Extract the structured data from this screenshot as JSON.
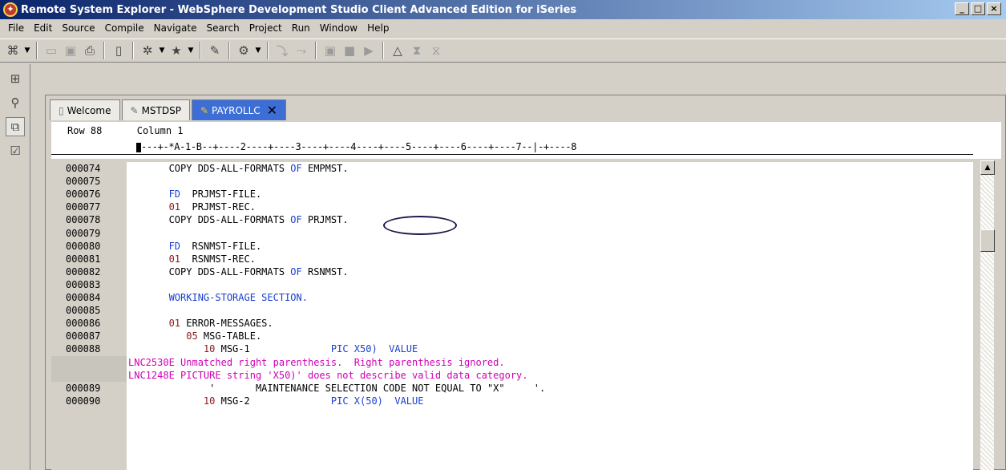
{
  "window": {
    "title": "Remote System Explorer - WebSphere Development Studio Client Advanced Edition for iSeries",
    "minimize": "_",
    "maximize": "□",
    "close": "×"
  },
  "menu": [
    "File",
    "Edit",
    "Source",
    "Compile",
    "Navigate",
    "Search",
    "Project",
    "Run",
    "Window",
    "Help"
  ],
  "tabs": [
    {
      "label": "Welcome",
      "icon": "page-icon"
    },
    {
      "label": "MSTDSP",
      "icon": "pencil-icon"
    },
    {
      "label": "PAYROLLC",
      "icon": "pencil-icon",
      "active": true,
      "close": "✕"
    }
  ],
  "editor": {
    "status_row": "Row 88",
    "status_column": "Column 1",
    "ruler": "---+-*A-1-B--+----2----+----3----+----4----+----5----+----6----+----7--|-+----8",
    "lines": [
      {
        "seq": "000074",
        "parts": [
          {
            "t": "COPY DDS-ALL-FORMATS ",
            "c": "txt"
          },
          {
            "t": "OF",
            "c": "kw"
          },
          {
            "t": " EMPMST.",
            "c": "txt"
          }
        ],
        "indent": "       "
      },
      {
        "seq": "000075",
        "parts": [],
        "indent": ""
      },
      {
        "seq": "000076",
        "parts": [
          {
            "t": "FD",
            "c": "kw"
          },
          {
            "t": "  PRJMST-FILE.",
            "c": "txt"
          }
        ],
        "indent": "       "
      },
      {
        "seq": "000077",
        "parts": [
          {
            "t": "01",
            "c": "num"
          },
          {
            "t": "  PRJMST-REC.",
            "c": "txt"
          }
        ],
        "indent": "       "
      },
      {
        "seq": "000078",
        "parts": [
          {
            "t": "COPY DDS-ALL-FORMATS ",
            "c": "txt"
          },
          {
            "t": "OF",
            "c": "kw"
          },
          {
            "t": " PRJMST.",
            "c": "txt"
          }
        ],
        "indent": "       "
      },
      {
        "seq": "000079",
        "parts": [],
        "indent": ""
      },
      {
        "seq": "000080",
        "parts": [
          {
            "t": "FD",
            "c": "kw"
          },
          {
            "t": "  RSNMST-FILE.",
            "c": "txt"
          }
        ],
        "indent": "       "
      },
      {
        "seq": "000081",
        "parts": [
          {
            "t": "01",
            "c": "num"
          },
          {
            "t": "  RSNMST-REC.",
            "c": "txt"
          }
        ],
        "indent": "       "
      },
      {
        "seq": "000082",
        "parts": [
          {
            "t": "COPY DDS-ALL-FORMATS ",
            "c": "txt"
          },
          {
            "t": "OF",
            "c": "kw"
          },
          {
            "t": " RSNMST.",
            "c": "txt"
          }
        ],
        "indent": "       "
      },
      {
        "seq": "000083",
        "parts": [],
        "indent": ""
      },
      {
        "seq": "000084",
        "parts": [
          {
            "t": "WORKING-STORAGE SECTION.",
            "c": "kw"
          }
        ],
        "indent": "       "
      },
      {
        "seq": "000085",
        "parts": [],
        "indent": ""
      },
      {
        "seq": "000086",
        "parts": [
          {
            "t": "01",
            "c": "num"
          },
          {
            "t": " ERROR-MESSAGES.",
            "c": "txt"
          }
        ],
        "indent": "       "
      },
      {
        "seq": "000087",
        "parts": [
          {
            "t": "05",
            "c": "num"
          },
          {
            "t": " MSG-TABLE.",
            "c": "txt"
          }
        ],
        "indent": "          "
      },
      {
        "seq": "000088",
        "parts": [
          {
            "t": "10",
            "c": "num"
          },
          {
            "t": " MSG-1              ",
            "c": "txt"
          },
          {
            "t": "PIC X50)",
            "c": "kw"
          },
          {
            "t": "  ",
            "c": "txt"
          },
          {
            "t": "VALUE",
            "c": "kw"
          }
        ],
        "indent": "             "
      },
      {
        "seq": "",
        "parts": [
          {
            "t": "LNC2530E Unmatched right parenthesis.  Right parenthesis ignored.",
            "c": "err"
          }
        ],
        "indent": ""
      },
      {
        "seq": "",
        "parts": [
          {
            "t": "LNC1248E PICTURE string 'X50)' does not describe valid data category.",
            "c": "err"
          }
        ],
        "indent": ""
      },
      {
        "seq": "000089",
        "parts": [
          {
            "t": "'       MAINTENANCE SELECTION CODE NOT EQUAL TO \"X\"     '.",
            "c": "txt"
          }
        ],
        "indent": "              "
      },
      {
        "seq": "000090",
        "parts": [
          {
            "t": "10",
            "c": "num"
          },
          {
            "t": " MSG-2              ",
            "c": "txt"
          },
          {
            "t": "PIC X(50)",
            "c": "kw"
          },
          {
            "t": "  ",
            "c": "txt"
          },
          {
            "t": "VALUE",
            "c": "kw"
          }
        ],
        "indent": "             "
      }
    ]
  },
  "scroll": {
    "up": "▲",
    "thumb_position": 0.23
  }
}
